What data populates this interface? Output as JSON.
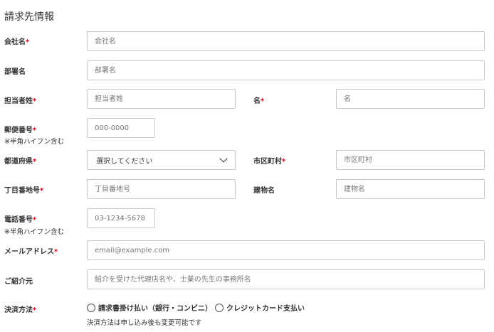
{
  "section_title": "請求先情報",
  "required_mark": "*",
  "fields": {
    "company": {
      "label": "会社名",
      "placeholder": "会社名"
    },
    "department": {
      "label": "部署名",
      "placeholder": "部署名"
    },
    "last_name": {
      "label": "担当者姓",
      "placeholder": "担当者姓"
    },
    "first_name": {
      "label": "名",
      "placeholder": "名"
    },
    "postal": {
      "label": "郵便番号",
      "sublabel": "※半角ハイフン含む",
      "placeholder": "000-0000"
    },
    "prefecture": {
      "label": "都道府県",
      "selected": "選択してください"
    },
    "city": {
      "label": "市区町村",
      "placeholder": "市区町村"
    },
    "address": {
      "label": "丁目番地号",
      "placeholder": "丁目番地号"
    },
    "building": {
      "label": "建物名",
      "placeholder": "建物名"
    },
    "phone": {
      "label": "電話番号",
      "sublabel": "※半角ハイフン含む",
      "placeholder": "03-1234-5678"
    },
    "email": {
      "label": "メールアドレス",
      "placeholder": "email@example.com"
    },
    "referral": {
      "label": "ご紹介元",
      "placeholder": "紹介を受けた代理店名や、士業の先生の事務所名"
    },
    "payment": {
      "label": "決済方法",
      "options": [
        "請求書掛け払い（銀行・コンビニ）",
        "クレジットカード支払い"
      ],
      "note": "決済方法は申し込み後も変更可能です"
    }
  }
}
